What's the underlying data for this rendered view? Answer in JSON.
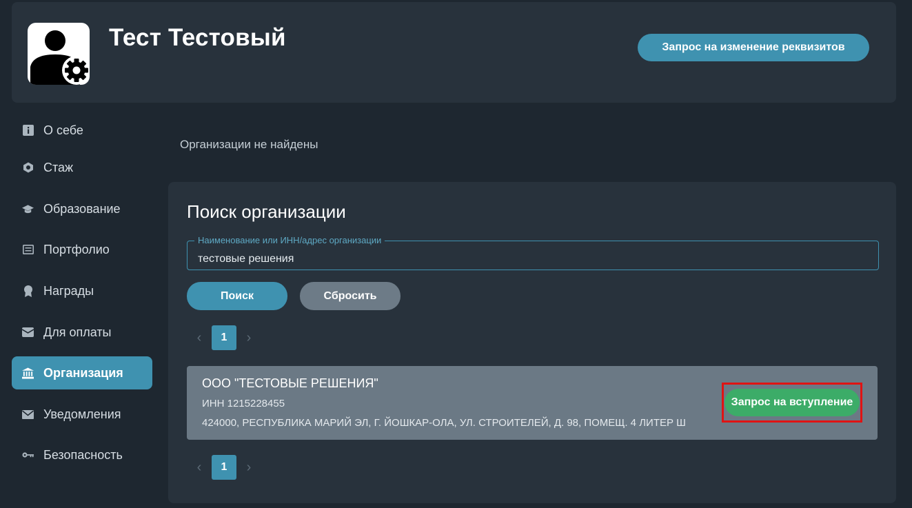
{
  "header": {
    "user_name": "Тест Тестовый",
    "request_details_label": "Запрос на изменение реквизитов"
  },
  "sidebar": {
    "items": [
      {
        "label": "О себе",
        "icon": "info-icon"
      },
      {
        "label": "Стаж",
        "icon": "hexagon-icon"
      },
      {
        "label": "Образование",
        "icon": "graduation-cap-icon"
      },
      {
        "label": "Портфолио",
        "icon": "portfolio-icon"
      },
      {
        "label": "Награды",
        "icon": "award-icon"
      },
      {
        "label": "Для оплаты",
        "icon": "wallet-icon"
      },
      {
        "label": "Организация",
        "icon": "bank-icon",
        "active": true
      },
      {
        "label": "Уведомления",
        "icon": "envelope-icon"
      },
      {
        "label": "Безопасность",
        "icon": "key-icon"
      }
    ]
  },
  "main": {
    "empty_message": "Организации не найдены",
    "search_panel": {
      "title": "Поиск организации",
      "field_label": "Наименование или ИНН/адрес организации",
      "field_value": "тестовые решения",
      "search_label": "Поиск",
      "reset_label": "Сбросить"
    },
    "pagination": {
      "prev": "‹",
      "next": "›",
      "current_page": "1"
    },
    "organizations": [
      {
        "name": "ООО \"ТЕСТОВЫЕ РЕШЕНИЯ\"",
        "inn": "ИНН 1215228455",
        "address": "424000, РЕСПУБЛИКА МАРИЙ ЭЛ, Г. ЙОШКАР-ОЛА, УЛ. СТРОИТЕЛЕЙ, Д. 98, ПОМЕЩ. 4 ЛИТЕР Ш",
        "join_label": "Запрос на вступление"
      }
    ]
  },
  "colors": {
    "accent": "#3f92b0",
    "background": "#1e2730",
    "panel": "#28323c",
    "card": "#6b7985",
    "success": "#3cac68",
    "highlight": "#e01313",
    "reset_button": "#6d7b87"
  }
}
